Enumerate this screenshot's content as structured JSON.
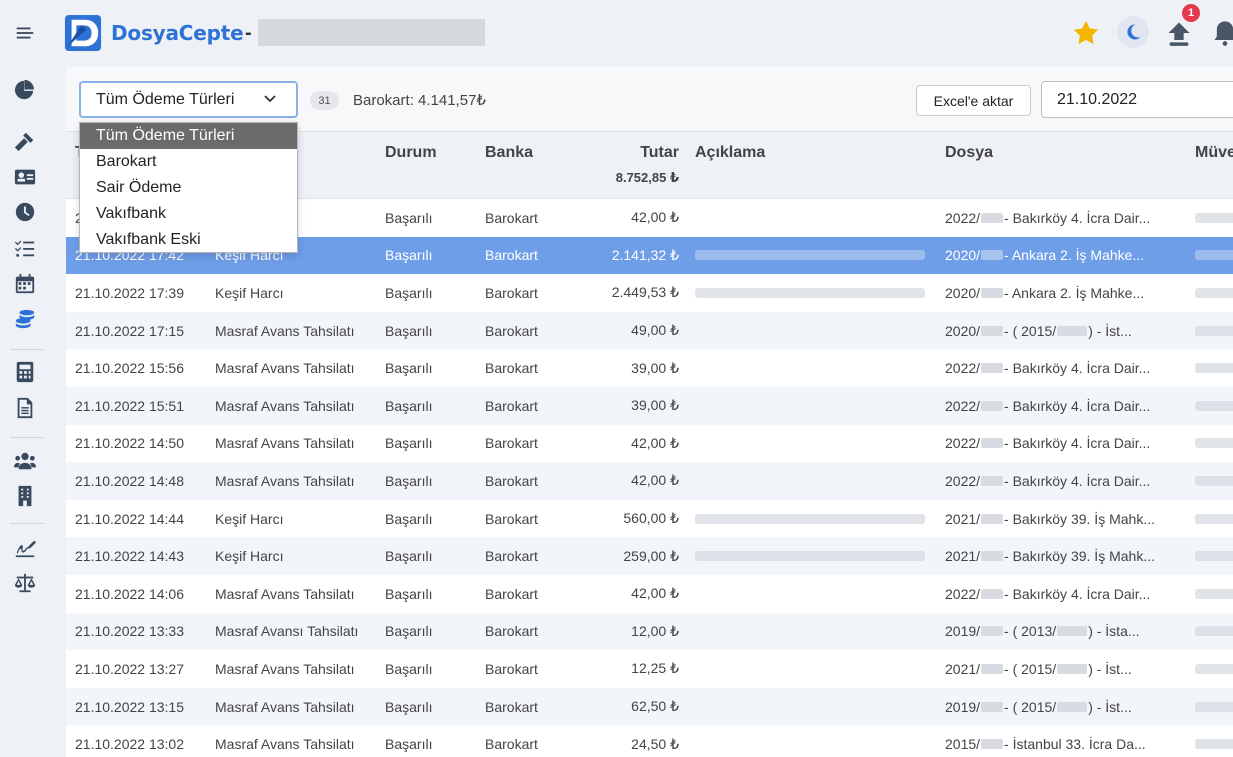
{
  "app": {
    "brand": "DosyaCepte",
    "dash": "-"
  },
  "header": {
    "notification_count": "1"
  },
  "toolbar": {
    "filter_selected": "Tüm Ödeme Türleri",
    "count": "31",
    "barokart_sum": "Barokart: 4.141,57₺",
    "excel_label": "Excel'e aktar",
    "date_value": "21.10.2022"
  },
  "dropdown": {
    "options": [
      "Tüm Ödeme Türleri",
      "Barokart",
      "Sair Ödeme",
      "Vakıfbank",
      "Vakıfbank Eski"
    ]
  },
  "table": {
    "headers": {
      "date": "T",
      "status": "Durum",
      "bank": "Banka",
      "amount": "Tutar",
      "amount_total": "8.752,85 ₺",
      "desc": "Açıklama",
      "file": "Dosya",
      "client": "Müve"
    },
    "rows": [
      {
        "date": "2",
        "type": "s Tahsilatı",
        "status": "Başarılı",
        "bank": "Barokart",
        "amount": "42,00 ₺",
        "file": "2022/",
        "file_rest": " - Bakırköy 4. İcra Dair..."
      },
      {
        "date": "21.10.2022 17:42",
        "type": "Keşif Harcı",
        "status": "Başarılı",
        "bank": "Barokart",
        "amount": "2.141,32 ₺",
        "file": "2020/",
        "file_rest": " - Ankara 2. İş Mahke..."
      },
      {
        "date": "21.10.2022 17:39",
        "type": "Keşif Harcı",
        "status": "Başarılı",
        "bank": "Barokart",
        "amount": "2.449,53 ₺",
        "file": "2020/",
        "file_rest": " - Ankara 2. İş Mahke..."
      },
      {
        "date": "21.10.2022 17:15",
        "type": "Masraf Avans Tahsilatı",
        "status": "Başarılı",
        "bank": "Barokart",
        "amount": "49,00 ₺",
        "file": "2020/",
        "file_rest": " - ( 2015/",
        "file_tail": " ) - İst..."
      },
      {
        "date": "21.10.2022 15:56",
        "type": "Masraf Avans Tahsilatı",
        "status": "Başarılı",
        "bank": "Barokart",
        "amount": "39,00 ₺",
        "file": "2022/",
        "file_rest": " - Bakırköy 4. İcra Dair..."
      },
      {
        "date": "21.10.2022 15:51",
        "type": "Masraf Avans Tahsilatı",
        "status": "Başarılı",
        "bank": "Barokart",
        "amount": "39,00 ₺",
        "file": "2022/",
        "file_rest": " - Bakırköy 4. İcra Dair..."
      },
      {
        "date": "21.10.2022 14:50",
        "type": "Masraf Avans Tahsilatı",
        "status": "Başarılı",
        "bank": "Barokart",
        "amount": "42,00 ₺",
        "file": "2022/",
        "file_rest": " - Bakırköy 4. İcra Dair..."
      },
      {
        "date": "21.10.2022 14:48",
        "type": "Masraf Avans Tahsilatı",
        "status": "Başarılı",
        "bank": "Barokart",
        "amount": "42,00 ₺",
        "file": "2022/",
        "file_rest": " - Bakırköy 4. İcra Dair..."
      },
      {
        "date": "21.10.2022 14:44",
        "type": "Keşif Harcı",
        "status": "Başarılı",
        "bank": "Barokart",
        "amount": "560,00 ₺",
        "file": "2021/",
        "file_rest": " - Bakırköy 39. İş Mahk..."
      },
      {
        "date": "21.10.2022 14:43",
        "type": "Keşif Harcı",
        "status": "Başarılı",
        "bank": "Barokart",
        "amount": "259,00 ₺",
        "file": "2021/",
        "file_rest": " - Bakırköy 39. İş Mahk..."
      },
      {
        "date": "21.10.2022 14:06",
        "type": "Masraf Avans Tahsilatı",
        "status": "Başarılı",
        "bank": "Barokart",
        "amount": "42,00 ₺",
        "file": "2022/",
        "file_rest": " - Bakırköy 4. İcra Dair..."
      },
      {
        "date": "21.10.2022 13:33",
        "type": "Masraf Avansı Tahsilatı",
        "status": "Başarılı",
        "bank": "Barokart",
        "amount": "12,00 ₺",
        "file": "2019/",
        "file_rest": " - ( 2013/",
        "file_tail": " ) - İsta..."
      },
      {
        "date": "21.10.2022 13:27",
        "type": "Masraf Avans Tahsilatı",
        "status": "Başarılı",
        "bank": "Barokart",
        "amount": "12,25 ₺",
        "file": "2021/",
        "file_rest": " - ( 2015/",
        "file_tail": " ) - İst..."
      },
      {
        "date": "21.10.2022 13:15",
        "type": "Masraf Avans Tahsilatı",
        "status": "Başarılı",
        "bank": "Barokart",
        "amount": "62,50 ₺",
        "file": "2019/",
        "file_rest": " - ( 2015/",
        "file_tail": " ) - İst..."
      },
      {
        "date": "21.10.2022 13:02",
        "type": "Masraf Avans Tahsilatı",
        "status": "Başarılı",
        "bank": "Barokart",
        "amount": "24,50 ₺",
        "file": "2015/",
        "file_rest": " - İstanbul 33. İcra Da..."
      }
    ]
  },
  "colors": {
    "accent": "#2f72d6",
    "selected_row": "#6f9ee9",
    "star": "#f5b400",
    "badge": "#e53950"
  },
  "icons": [
    "menu-icon",
    "pie-chart-icon",
    "gavel-icon",
    "id-card-icon",
    "clock-icon",
    "checklist-icon",
    "calendar-icon",
    "coins-icon",
    "calculator-icon",
    "document-icon",
    "users-icon",
    "building-icon",
    "signature-icon",
    "scale-icon",
    "star-icon",
    "moon-icon",
    "upload-icon",
    "bell-icon"
  ]
}
